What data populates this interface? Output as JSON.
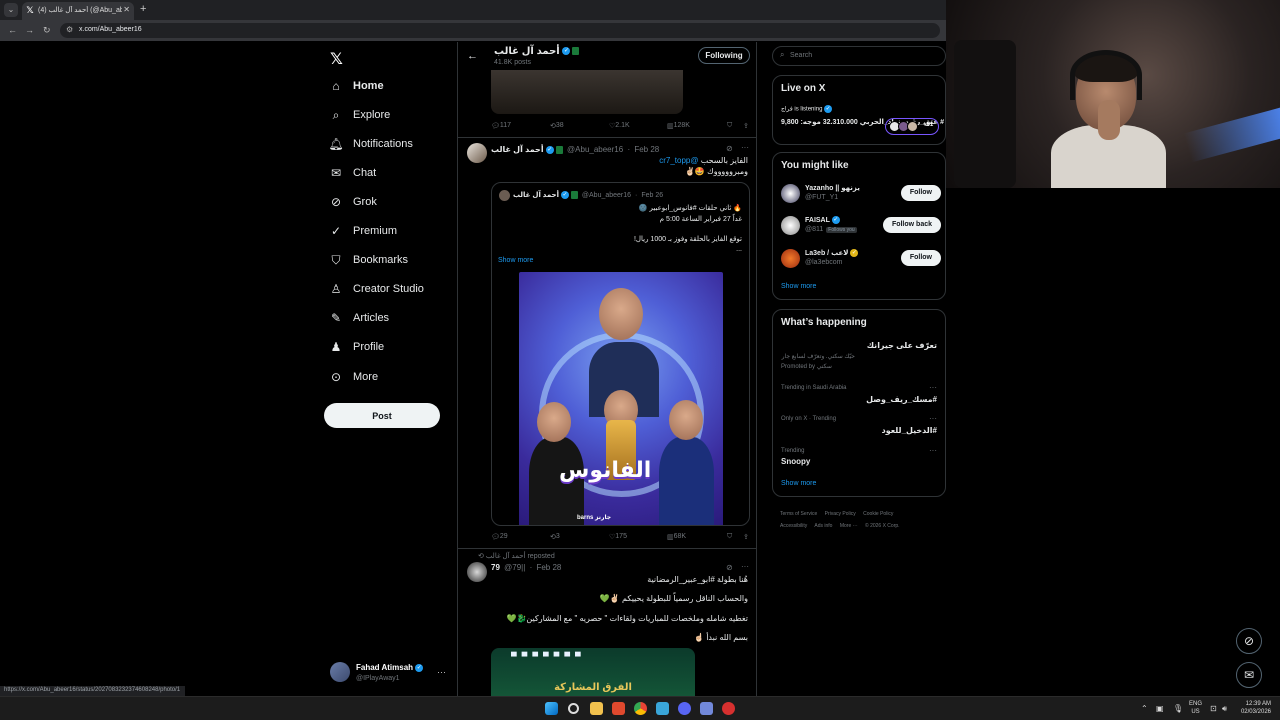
{
  "browser": {
    "tab_title": "(4) أحمد آل غالب (@Abu_abeer16",
    "url": "x.com/Abu_abeer16",
    "status_url": "https://x.com/Abu_abeer16/status/2027083232374608248/photo/1"
  },
  "nav": {
    "items": [
      {
        "label": "Home",
        "icon": "home-icon"
      },
      {
        "label": "Explore",
        "icon": "search-icon"
      },
      {
        "label": "Notifications",
        "icon": "bell-icon"
      },
      {
        "label": "Chat",
        "icon": "mail-icon"
      },
      {
        "label": "Grok",
        "icon": "grok-icon"
      },
      {
        "label": "Premium",
        "icon": "premium-icon"
      },
      {
        "label": "Bookmarks",
        "icon": "bookmark-icon"
      },
      {
        "label": "Creator Studio",
        "icon": "creator-icon"
      },
      {
        "label": "Articles",
        "icon": "articles-icon"
      },
      {
        "label": "Profile",
        "icon": "person-icon"
      },
      {
        "label": "More",
        "icon": "more-circle-icon"
      }
    ],
    "post_label": "Post",
    "account": {
      "name": "Fahad Atimsah",
      "handle": "@IPlayAway1"
    }
  },
  "profile_header": {
    "name": "أحمد آل غالب",
    "posts": "41.8K posts",
    "following_label": "Following"
  },
  "tweets": [
    {
      "stats": {
        "replies": "117",
        "reposts": "38",
        "likes": "2.1K",
        "views": "128K"
      }
    },
    {
      "name": "أحمد آل غالب",
      "handle": "@Abu_abeer16",
      "date": "Feb 28",
      "line1": "الفايز بالسحب",
      "mention": "@cr7_topp",
      "line2": "ومبروووووك 🤩✌🏻",
      "quote": {
        "name": "أحمد آل غالب",
        "handle": "@Abu_abeer16",
        "date": "Feb 26",
        "line1": "🔥 ثاني حلقات #فانوس_ابوعبير 🌚",
        "line2": "غداً 27 فبراير الساعة 5:00 م",
        "line3": "توقع الفايز بالحلقة وفوز بـ 1000 ريال!",
        "line4": "...",
        "show_more": "Show more",
        "poster_title": "الفانوس",
        "poster_footer": "barns جارنز"
      },
      "stats": {
        "replies": "29",
        "reposts": "3",
        "likes": "175",
        "views": "68K"
      }
    },
    {
      "repost_by": "أحمد آل غالب reposted",
      "name": "79",
      "handle": "@79||",
      "date": "Feb 28",
      "line1": "هُنا بطولة #ابو_عبير_الرمضانية",
      "line2": "والحساب الناقل رسمياً للبطولة يحييكم ✌🏻💚",
      "line3": "تغطيه شامله وملخصات للمباريات ولقاءات \" حصريه \" مع المشاركين🐉💚",
      "line4": "بسم الله نبدأ ☝🏻",
      "image_text": "الفرق المشاركة"
    }
  ],
  "right": {
    "search_placeholder": "Search",
    "live": {
      "title": "Live on X",
      "host": "فراج is listening",
      "space_title": "# عتق_رقبه_زياد_الحربي 32.310.000 موجه: 9,800",
      "count": "+61"
    },
    "you_might_like": {
      "title": "You might like",
      "accounts": [
        {
          "name": "Yazanho || يزنهو",
          "handle": "@FUT_Y1",
          "button": "Follow",
          "follows_you": ""
        },
        {
          "name": "FAISAL",
          "handle": "@811",
          "button": "Follow back",
          "follows_you": "Follows you"
        },
        {
          "name": "La3eb / لاعب",
          "handle": "@la3ebcom",
          "button": "Follow",
          "follows_you": ""
        }
      ],
      "show_more": "Show more"
    },
    "happening": {
      "title": "What’s happening",
      "promo_title": "تعرّف على جيرانك",
      "promo_sub": "حيّك سكني. وتعرّف لسابع جار",
      "promo_label": "Promoted by سكني",
      "trends": [
        {
          "meta": "Trending in Saudi Arabia",
          "title": "#مسك_ريف_وصل"
        },
        {
          "meta": "Only on X · Trending",
          "title": "#الدخيل_للعود"
        },
        {
          "meta": "Trending",
          "title": "Snoopy"
        }
      ],
      "show_more": "Show more"
    },
    "footer": [
      "Terms of Service",
      "Privacy Policy",
      "Cookie Policy",
      "Accessibility",
      "Ads info",
      "More ···",
      "© 2026 X Corp."
    ]
  },
  "taskbar": {
    "lang_top": "ENG",
    "lang_bottom": "US",
    "time": "12:39 AM",
    "date": "02/03/2026"
  }
}
